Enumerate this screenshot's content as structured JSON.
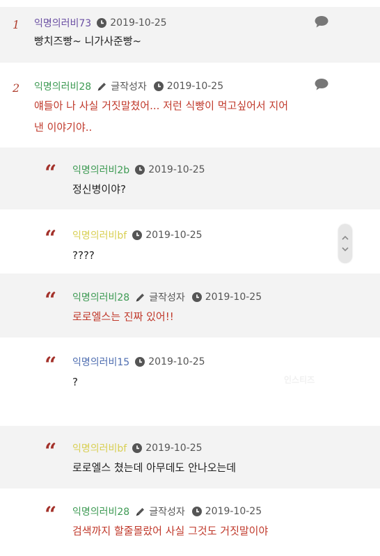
{
  "comments": [
    {
      "number": "1",
      "author": "익명의러비73",
      "author_color": "#6a4fa3",
      "date": "2019-10-25",
      "text": "빵치즈빵~ 니가사준빵~",
      "text_color": "#222222"
    },
    {
      "number": "2",
      "author": "익명의러비28",
      "author_color": "#3d9a53",
      "badge": "글작성자",
      "date": "2019-10-25",
      "text_line1": "얘들아 나 사실 거짓말쳤어... 저런 식빵이 먹고싶어서 지어",
      "text_line2": "낸 이야기야..",
      "text_color": "#c0392b"
    }
  ],
  "replies": [
    {
      "author": "익명의러비2b",
      "author_color": "#3d9a53",
      "date": "2019-10-25",
      "text": "정신병이야?"
    },
    {
      "author": "익명의러비bf",
      "author_color": "#d8cf52",
      "date": "2019-10-25",
      "text": "????"
    },
    {
      "author": "익명의러비28",
      "author_color": "#3d9a53",
      "badge": "글작성자",
      "date": "2019-10-25",
      "text": "로로엘스는 진짜 있어!!"
    },
    {
      "author": "익명의러비15",
      "author_color": "#4e6db0",
      "date": "2019-10-25",
      "text": "?"
    },
    {
      "author": "익명의러비bf",
      "author_color": "#d8cf52",
      "date": "2019-10-25",
      "text": "로로엘스 쳤는데 아무데도 안나오는데"
    },
    {
      "author": "익명의러비28",
      "author_color": "#3d9a53",
      "badge": "글작성자",
      "date": "2019-10-25",
      "text": "검색까지 할줄몰랐어 사실 그것도 거짓말이야"
    }
  ],
  "quote_glyph": "“",
  "watermark": "인스티즈",
  "icons": {
    "date": "clock-icon",
    "reply": "speech-bubble-icon",
    "writer": "pencil-icon",
    "scroll": "scroll-up-down-icon"
  }
}
